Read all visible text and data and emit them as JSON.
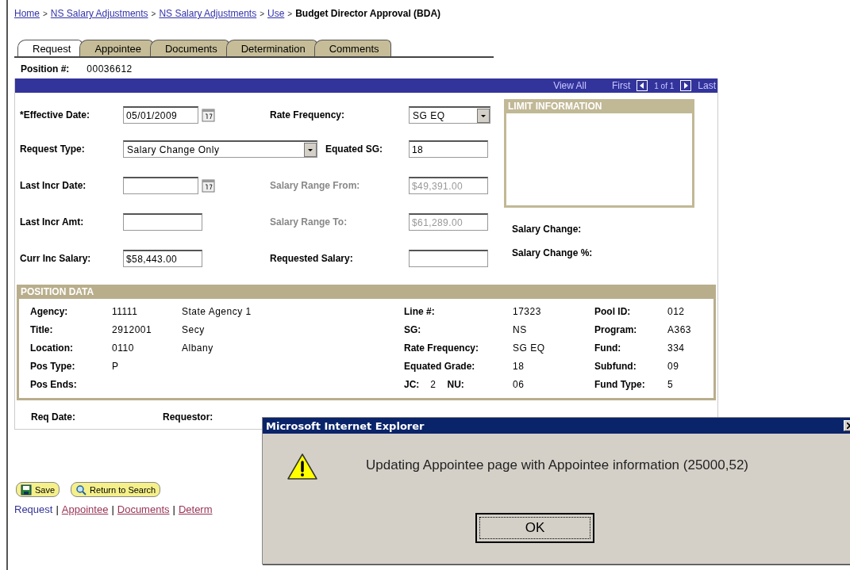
{
  "breadcrumb": [
    {
      "label": "Home",
      "kind": "link"
    },
    {
      "label": "NS Salary Adjustments",
      "kind": "link"
    },
    {
      "label": "NS Salary Adjustments",
      "kind": "link"
    },
    {
      "label": "Use",
      "kind": "link"
    },
    {
      "label": "Budget Director Approval (BDA)",
      "kind": "current"
    }
  ],
  "breadcrumb_separator": ">",
  "tabs": [
    {
      "label": "Request",
      "selected": true
    },
    {
      "label": "Appointee",
      "selected": false
    },
    {
      "label": "Documents",
      "selected": false
    },
    {
      "label": "Determination",
      "selected": false
    },
    {
      "label": "Comments",
      "selected": false
    }
  ],
  "position": {
    "label": "Position #:",
    "value": "00036612"
  },
  "grid_nav": {
    "view_all": "View All",
    "first": "First",
    "counter": "1 of 1",
    "last": "Last"
  },
  "form_rows": [
    {
      "left": {
        "label": "*Effective Date:",
        "value": "05/01/2009",
        "kind": "date",
        "disabled": false
      },
      "right": {
        "label": "Rate Frequency:",
        "value": "SG EQ",
        "kind": "select",
        "disabled": false
      }
    },
    {
      "left": {
        "label": "Request Type:",
        "value": "Salary Change Only",
        "kind": "wide_select",
        "disabled": false
      },
      "right": {
        "label": "Equated SG:",
        "value": "18",
        "kind": "text",
        "disabled": false
      }
    },
    {
      "left": {
        "label": "Last Incr Date:",
        "kind": "date",
        "disabled": false
      },
      "right": {
        "label": "Salary Range From:",
        "value": "$49,391.00",
        "kind": "text",
        "disabled": true
      }
    },
    {
      "left": {
        "label": "Last Incr Amt:",
        "kind": "text",
        "disabled": false
      },
      "right": {
        "label": "Salary Range To:",
        "value": "$61,289.00",
        "kind": "text",
        "disabled": true
      }
    },
    {
      "left": {
        "label": "Curr Inc Salary:",
        "value": "$58,443.00",
        "kind": "text",
        "disabled": false
      },
      "right": {
        "label": "Requested Salary:",
        "kind": "text",
        "disabled": false
      }
    }
  ],
  "limit_info": {
    "title": "LIMIT INFORMATION"
  },
  "salary_labels": [
    "Salary Change:",
    "Salary Change %:"
  ],
  "position_data": {
    "title": "POSITION DATA",
    "rows": [
      {
        "left": {
          "label": "Agency:",
          "code": "11111",
          "name": "State Agency 1"
        },
        "mid": {
          "label": "Line #:",
          "value": "17323"
        },
        "right": {
          "label": "Pool ID:",
          "value": "012"
        }
      },
      {
        "left": {
          "label": "Title:",
          "code": "2912001",
          "name": "Secy"
        },
        "mid": {
          "label": "SG:",
          "value": "NS"
        },
        "right": {
          "label": "Program:",
          "value": "A363"
        }
      },
      {
        "left": {
          "label": "Location:",
          "code": "0110",
          "name": "Albany"
        },
        "mid": {
          "label": "Rate Frequency:",
          "value": "SG EQ"
        },
        "right": {
          "label": "Fund:",
          "value": "334"
        }
      },
      {
        "left": {
          "label": "Pos Type:",
          "code": "P"
        },
        "mid": {
          "label": "Equated Grade:",
          "value": "18"
        },
        "right": {
          "label": "Subfund:",
          "value": "09"
        }
      },
      {
        "left": {
          "label": "Pos Ends:"
        },
        "mid": {
          "label": "JC:",
          "extra_value": "2",
          "extra_label": "NU:",
          "value": "06"
        },
        "right": {
          "label": "Fund Type:",
          "value": "5"
        }
      }
    ]
  },
  "footer_labels": [
    "Req Date:",
    "Requestor:"
  ],
  "buttons": [
    {
      "label": "Save",
      "kind": "save"
    },
    {
      "label": "Return to Search",
      "kind": "search"
    }
  ],
  "page_links": [
    {
      "label": "Request",
      "selected": true
    },
    {
      "label": "Appointee",
      "selected": false
    },
    {
      "label": "Documents",
      "selected": false
    },
    {
      "label": "Determ",
      "selected": false
    }
  ],
  "page_link_separator": "|",
  "dialog": {
    "title": "Microsoft Internet Explorer",
    "message": "Updating Appointee page with Appointee information (25000,52)",
    "button": "OK"
  }
}
